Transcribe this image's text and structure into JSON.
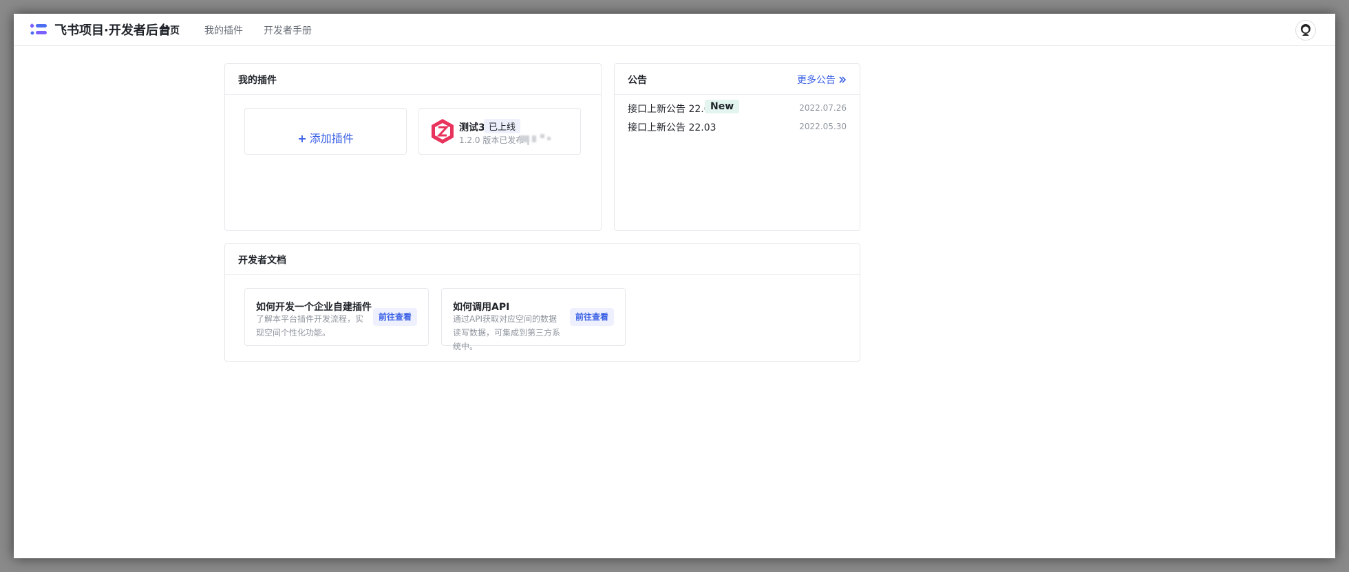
{
  "header": {
    "brand": "飞书项目·开发者后台",
    "nav": [
      {
        "label": "首页",
        "active": true
      },
      {
        "label": "我的插件",
        "active": false
      },
      {
        "label": "开发者手册",
        "active": false
      }
    ]
  },
  "my_plugins": {
    "title": "我的插件",
    "add_label": "添加插件",
    "plugin": {
      "name": "测试3",
      "status": "已上线",
      "meta": "1.2.0 版本已发布 |"
    }
  },
  "notices": {
    "title": "公告",
    "more_label": "更多公告",
    "items": [
      {
        "title": "接口上新公告 22.07",
        "badge": "New",
        "date": "2022.07.26"
      },
      {
        "title": "接口上新公告 22.03",
        "badge": "",
        "date": "2022.05.30"
      }
    ]
  },
  "docs": {
    "title": "开发者文档",
    "items": [
      {
        "title": "如何开发一个企业自建插件",
        "desc": "了解本平台插件开发流程，实现空间个性化功能。",
        "button": "前往查看"
      },
      {
        "title": "如何调用API",
        "desc": "通过API获取对应空间的数据读写数据，可集成到第三方系统中。",
        "button": "前往查看"
      }
    ]
  },
  "colors": {
    "accent": "#3a60e5",
    "brand_icon": "#7b61ff",
    "plugin_icon": "#e8335c",
    "new_badge_bg": "#e3f5ee"
  }
}
